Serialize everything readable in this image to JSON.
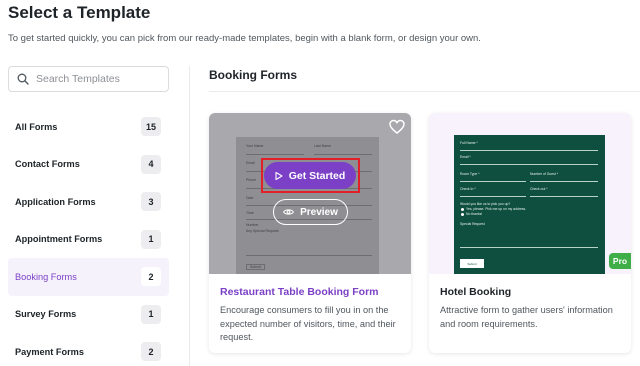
{
  "header": {
    "title": "Select a Template",
    "subtitle": "To get started quickly, you can pick from our ready-made templates, begin with a blank form, or design your own."
  },
  "search": {
    "placeholder": "Search Templates",
    "value": "",
    "icon": "search-icon"
  },
  "categories": [
    {
      "label": "All Forms",
      "count": "15",
      "active": false
    },
    {
      "label": "Contact Forms",
      "count": "4",
      "active": false
    },
    {
      "label": "Application Forms",
      "count": "3",
      "active": false
    },
    {
      "label": "Appointment Forms",
      "count": "1",
      "active": false
    },
    {
      "label": "Booking Forms",
      "count": "2",
      "active": true
    },
    {
      "label": "Survey Forms",
      "count": "1",
      "active": false
    },
    {
      "label": "Payment Forms",
      "count": "2",
      "active": false
    }
  ],
  "main": {
    "section_title": "Booking Forms",
    "templates": [
      {
        "title": "Restaurant Table Booking Form",
        "description": "Encourage consumers to fill you in on the expected number of visitors, time, and their request.",
        "get_started_label": "Get Started",
        "preview_label": "Preview",
        "favorite_icon": "heart-outline-icon",
        "preview_form": {
          "labels": [
            "Your Name",
            "Last Name",
            "Email",
            "Phone",
            "Date",
            "Time",
            "Number",
            "Any Special Request"
          ],
          "submit": "Submit"
        }
      },
      {
        "title": "Hotel Booking",
        "description": "Attractive form to gather users' information and room requirements.",
        "badge": "Pro",
        "preview_form": {
          "labels": [
            "Full Name *",
            "Email *",
            "Room Type *",
            "Number of Guest *",
            "Check In *",
            "Check out *",
            "Would you like us to pick you up?",
            "Yes, please. Pick me up on my address.",
            "No thanks!",
            "Special Request"
          ],
          "submit": "Submit"
        }
      }
    ]
  },
  "colors": {
    "accent": "#7b40c6",
    "highlight": "#e2202a",
    "hotel_bg": "#0f4f3f",
    "pro_badge": "#3fae49"
  }
}
